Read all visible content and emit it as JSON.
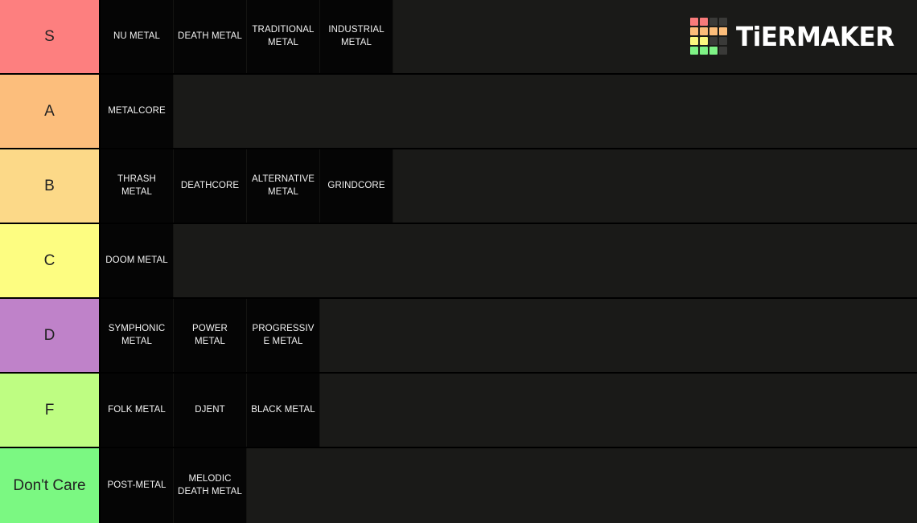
{
  "app": {
    "title": "TierMaker",
    "logo_text": "TiERMAKER",
    "background_color": "#1a1a18",
    "item_color": "#050505",
    "divider_color": "#000000"
  },
  "logo_grid": {
    "name": "tiermaker-logo-grid",
    "colors": [
      "#f97b7b",
      "#f97b7b",
      "#3a3a38",
      "#3a3a38",
      "#fcbd7a",
      "#fcbd7a",
      "#fcbd7a",
      "#fcbd7a",
      "#fbf87f",
      "#fbf87f",
      "#3a3a38",
      "#3a3a38",
      "#7ef285",
      "#7ef285",
      "#7ef285",
      "#3a3a38"
    ]
  },
  "tiers": [
    {
      "label": "S",
      "color": "#fd7f7f",
      "label_text_color": "#222222",
      "items": [
        {
          "label": "NU METAL"
        },
        {
          "label": "DEATH METAL"
        },
        {
          "label": "TRADITIONAL METAL"
        },
        {
          "label": "INDUSTRIAL METAL"
        }
      ]
    },
    {
      "label": "A",
      "color": "#fcbe7c",
      "label_text_color": "#222222",
      "items": [
        {
          "label": "METALCORE"
        }
      ]
    },
    {
      "label": "B",
      "color": "#fcd988",
      "label_text_color": "#222222",
      "items": [
        {
          "label": "THRASH METAL"
        },
        {
          "label": "DEATHCORE"
        },
        {
          "label": "ALTERNATIVE METAL"
        },
        {
          "label": "GRINDCORE"
        }
      ]
    },
    {
      "label": "C",
      "color": "#fdfd81",
      "label_text_color": "#222222",
      "items": [
        {
          "label": "DOOM METAL"
        }
      ]
    },
    {
      "label": "D",
      "color": "#bf82c9",
      "label_text_color": "#222222",
      "items": [
        {
          "label": "SYMPHONIC METAL"
        },
        {
          "label": "POWER METAL"
        },
        {
          "label": "PROGRESSIVE METAL"
        }
      ]
    },
    {
      "label": "F",
      "color": "#befd82",
      "label_text_color": "#222222",
      "items": [
        {
          "label": "FOLK METAL"
        },
        {
          "label": "DJENT"
        },
        {
          "label": "BLACK METAL"
        }
      ]
    },
    {
      "label": "Don't Care",
      "color": "#7bf882",
      "label_text_color": "#222222",
      "items": [
        {
          "label": "POST-METAL"
        },
        {
          "label": "MELODIC DEATH METAL"
        }
      ]
    }
  ]
}
